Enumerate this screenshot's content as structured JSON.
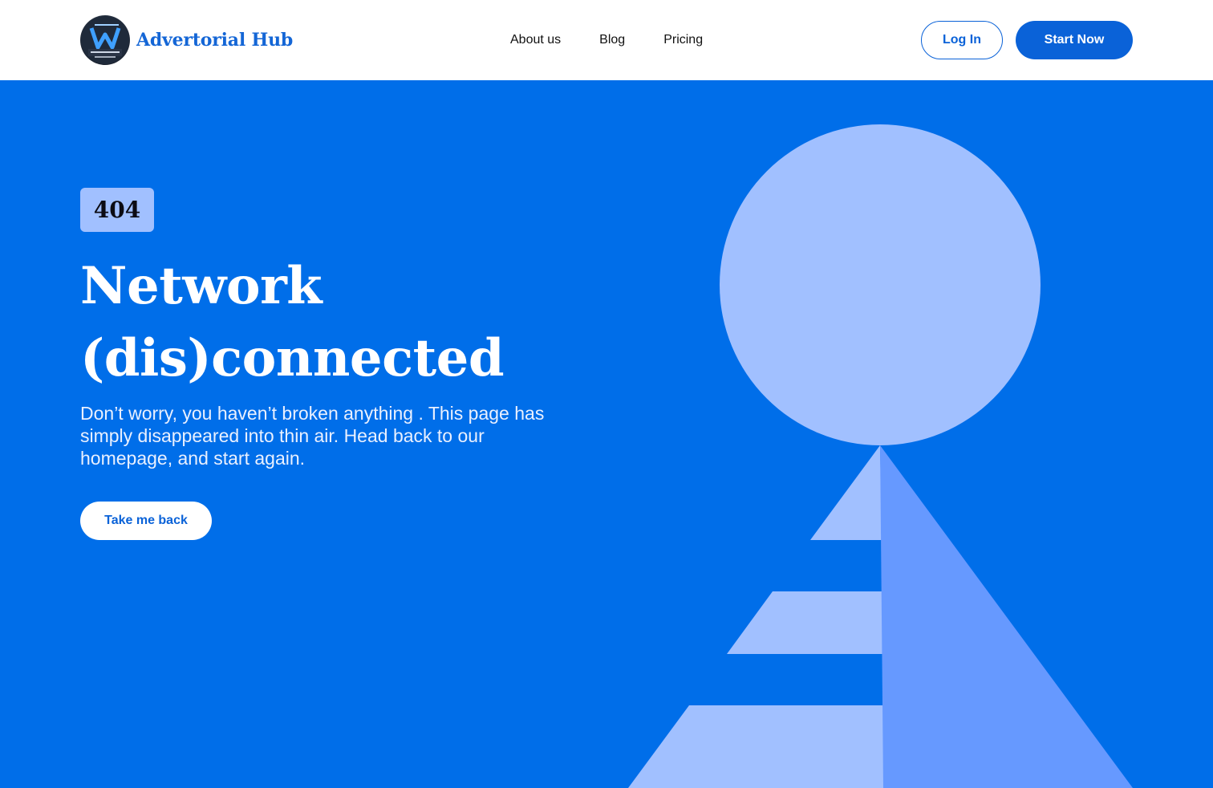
{
  "header": {
    "brand": "Advertorial Hub",
    "nav": [
      "About us",
      "Blog",
      "Pricing"
    ],
    "login_label": "Log In",
    "start_label": "Start Now"
  },
  "hero": {
    "code": "404",
    "title_line1": "Network",
    "title_line2": "(dis)connected",
    "subtitle": "Don’t worry, you haven’t broken anything . This page has simply disappeared into thin air. Head back to our homepage, and start again.",
    "back_label": "Take me back"
  },
  "colors": {
    "brand": "#0a62d8",
    "hero_bg": "#006ee9",
    "shape_light": "#a1c0ff",
    "shape_mid": "#6699ff"
  }
}
